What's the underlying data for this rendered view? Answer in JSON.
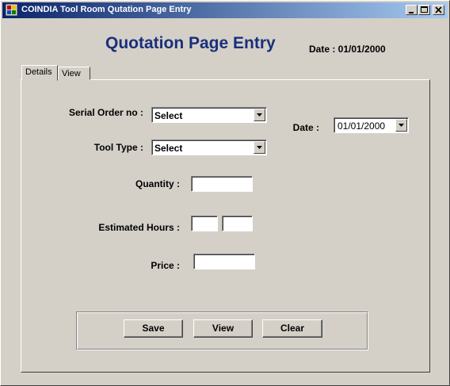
{
  "window": {
    "title": "COINDIA Tool Room Qutation Page Entry"
  },
  "header": {
    "title": "Quotation Page Entry",
    "date_label": "Date : 01/01/2000"
  },
  "tabs": [
    {
      "label": "Details",
      "active": true
    },
    {
      "label": "View",
      "active": false
    }
  ],
  "form": {
    "serial_order_label": "Serial Order no :",
    "serial_order_value": "Select",
    "tool_type_label": "Tool Type :",
    "tool_type_value": "Select",
    "date_label": "Date :",
    "date_value": "01/01/2000",
    "quantity_label": "Quantity :",
    "quantity_value": "",
    "estimated_hours_label": "Estimated Hours :",
    "estimated_hours_value_1": "",
    "estimated_hours_value_2": "",
    "price_label": "Price :",
    "price_value": ""
  },
  "buttons": {
    "save": "Save",
    "view": "View",
    "clear": "Clear"
  },
  "colors": {
    "title_start": "#0a246a",
    "title_end": "#a6caf0",
    "heading": "#1a2f7a",
    "face": "#d4d0c8"
  }
}
